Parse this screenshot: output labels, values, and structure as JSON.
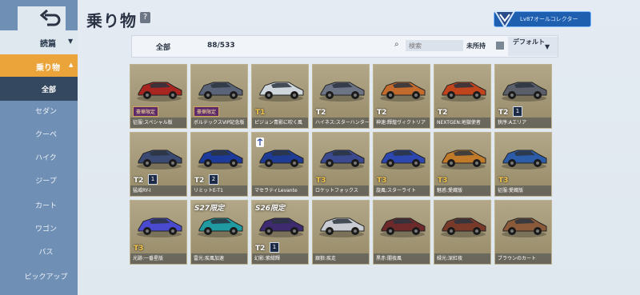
{
  "header": {
    "title": "乗り物",
    "help": "?",
    "badge": "Lv87オールコレクター"
  },
  "sidebar": {
    "category": "読篇",
    "active": "乗り物",
    "sub": "全部",
    "items": [
      "セダン",
      "クーペ",
      "ハイク",
      "ジープ",
      "カート",
      "ワゴン",
      "バス",
      "ピックアップ"
    ]
  },
  "filter": {
    "all_label": "全部",
    "count": "88/533",
    "search_placeholder": "検索",
    "unowned_label": "未所持",
    "sort_label": "デフォルト"
  },
  "colors": {
    "sidebar": "#6f8fb4",
    "active": "#eaa43a",
    "card": "#a89c7c"
  },
  "cards": [
    {
      "label": "征服:スペシャル版",
      "tier": "",
      "tag": "豪華限定",
      "car": "#a8261f"
    },
    {
      "label": "ボルテックスVIP記念版",
      "tier": "",
      "tag": "豪華限定",
      "car": "#5a6478"
    },
    {
      "label": "ピジョン青影に吹く風",
      "tier": "T1",
      "tag": "",
      "car": "#cfd6dc"
    },
    {
      "label": "ハイネス:スターハンター",
      "tier": "T2",
      "tag": "",
      "car": "#6c7486"
    },
    {
      "label": "神速:輝煌ヴィクトリア",
      "tier": "T2",
      "tag": "",
      "car": "#c36a2d"
    },
    {
      "label": "NEXTGEN:地獄使者",
      "tier": "T2",
      "tag": "",
      "car": "#c1451c"
    },
    {
      "label": "狭序:Aエリア",
      "tier": "T2",
      "lv": "1",
      "car": "#5a5f6a"
    },
    {
      "label": "猛威RY-I",
      "tier": "T2",
      "lv": "1",
      "car": "#3a4a72"
    },
    {
      "label": "リミットE-T1",
      "tier": "T2",
      "lv": "2",
      "car": "#1c3a9a"
    },
    {
      "label": "マセラティLevante",
      "tier": "",
      "logo": true,
      "car": "#1f3c94"
    },
    {
      "label": "ロケットフォックス",
      "tier": "T3",
      "car": "#3b4a8f"
    },
    {
      "label": "旋風:スターライト",
      "tier": "T3",
      "car": "#2c47b0"
    },
    {
      "label": "魅惑:愛蔵版",
      "tier": "T3",
      "car": "#c07a2a"
    },
    {
      "label": "征服:愛蔵版",
      "tier": "T3",
      "car": "#2c5ca8"
    },
    {
      "label": "光跡:一番星版",
      "tier": "T3",
      "car": "#4a4ad0"
    },
    {
      "label": "雷光:疾風加速",
      "tier": "",
      "season": "S27限定",
      "car": "#1f9aa0"
    },
    {
      "label": "幻影:紫紺輝",
      "tier": "T2",
      "lv": "1",
      "season": "S26限定",
      "car": "#3e2a6e"
    },
    {
      "label": "銀狼:疾走",
      "tier": "",
      "car": "#c8ccd2"
    },
    {
      "label": "黒赤:闇夜風",
      "tier": "",
      "car": "#6e2a2a"
    },
    {
      "label": "緑光:深紅夜",
      "tier": "",
      "car": "#7a3a2a"
    },
    {
      "label": "ブラウンのカート",
      "tier": "",
      "car": "#8b5a3a"
    }
  ]
}
